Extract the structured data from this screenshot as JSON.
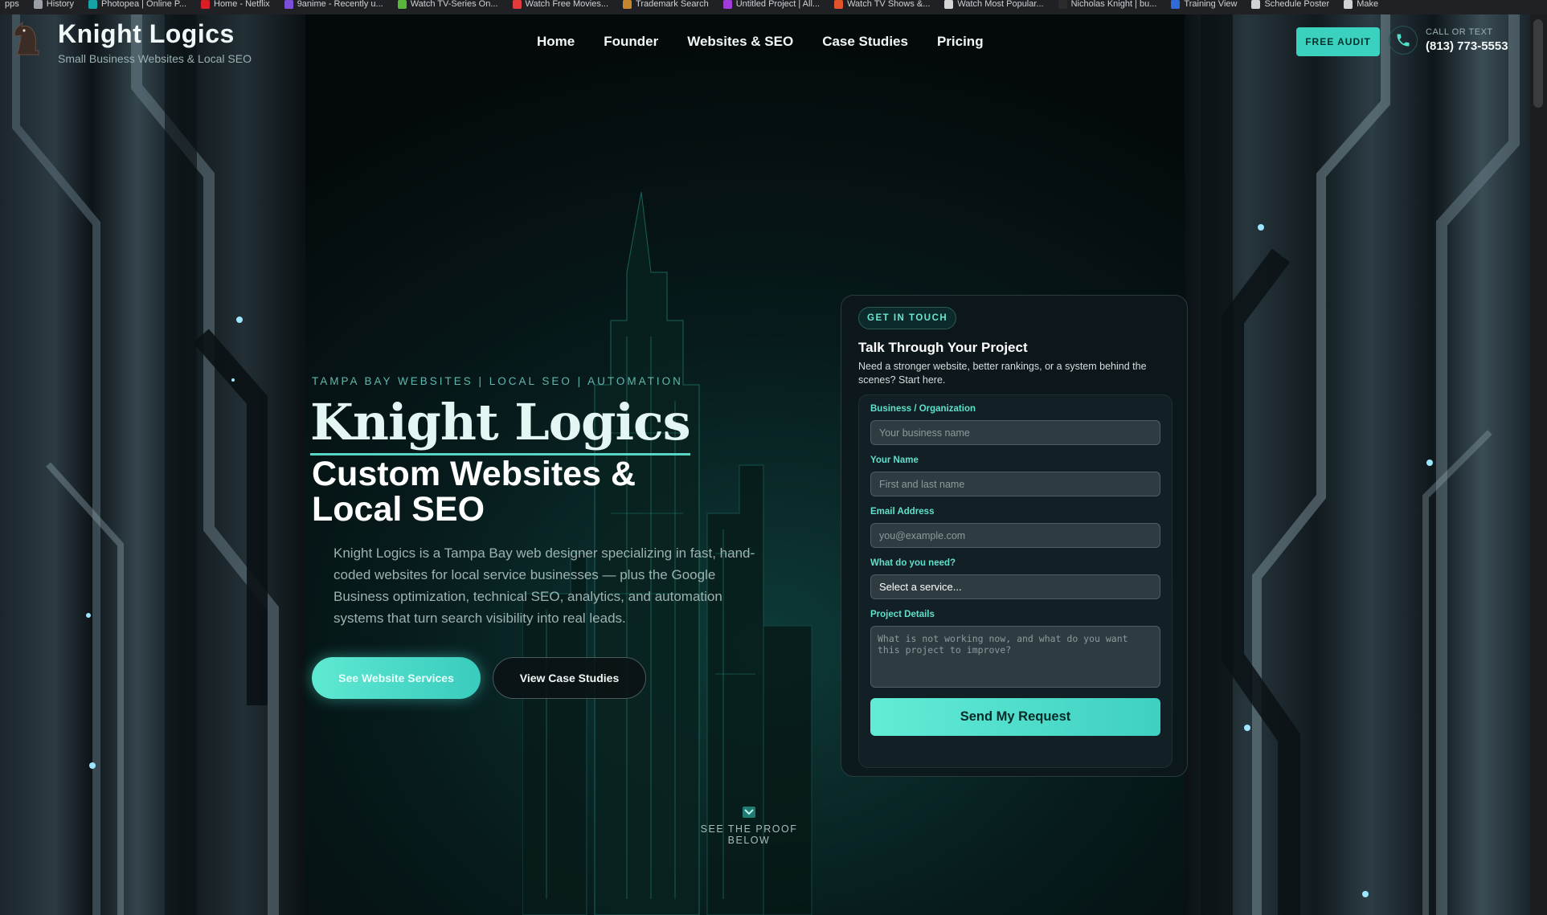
{
  "bookmarks": [
    {
      "label": "pps",
      "color": "#9aa0a6"
    },
    {
      "label": "History",
      "color": "#9aa0a6"
    },
    {
      "label": "Photopea | Online P...",
      "color": "#17a2a6"
    },
    {
      "label": "Home - Netflix",
      "color": "#d81f26"
    },
    {
      "label": "9anime - Recently u...",
      "color": "#7b4fd8"
    },
    {
      "label": "Watch TV-Series On...",
      "color": "#58b63a"
    },
    {
      "label": "Watch Free Movies...",
      "color": "#e13b3b"
    },
    {
      "label": "Trademark Search",
      "color": "#c5872d"
    },
    {
      "label": "Untitled Project | All...",
      "color": "#a13bd9"
    },
    {
      "label": "Watch TV Shows &...",
      "color": "#e2522d"
    },
    {
      "label": "Watch Most Popular...",
      "color": "#d5d5d5"
    },
    {
      "label": "Nicholas Knight | bu...",
      "color": "#2b2b2b"
    },
    {
      "label": "Training View",
      "color": "#2f6bd9"
    },
    {
      "label": "Schedule Poster",
      "color": "#cfd3d6"
    },
    {
      "label": "Make",
      "color": "#cfd3d6"
    }
  ],
  "header": {
    "logo_title": "Knight Logics",
    "logo_subtitle": "Small Business Websites & Local SEO",
    "nav": [
      "Home",
      "Founder",
      "Websites & SEO",
      "Case Studies",
      "Pricing"
    ],
    "audit_button": "FREE AUDIT",
    "call_label": "CALL OR TEXT",
    "call_number": "(813) 773-5553"
  },
  "hero": {
    "eyebrow": "TAMPA BAY WEBSITES | LOCAL SEO | AUTOMATION",
    "title": "Knight Logics",
    "subtitle": "Custom Websites & Local SEO",
    "description": "Knight Logics is a Tampa Bay web designer specializing in fast, hand-coded websites for local service businesses — plus the Google Business optimization, technical SEO, analytics, and automation systems that turn search visibility into real leads.",
    "primary_button": "See Website Services",
    "secondary_button": "View Case Studies",
    "proof_label": "SEE THE PROOF BELOW"
  },
  "contact": {
    "badge": "GET IN TOUCH",
    "title": "Talk Through Your Project",
    "description": "Need a stronger website, better rankings, or a system behind the scenes? Start here.",
    "fields": {
      "business_label": "Business / Organization",
      "business_placeholder": "Your business name",
      "name_label": "Your Name",
      "name_placeholder": "First and last name",
      "email_label": "Email Address",
      "email_placeholder": "you@example.com",
      "need_label": "What do you need?",
      "need_selected": "Select a service...",
      "details_label": "Project Details",
      "details_placeholder": "What is not working now, and what do you want this project to improve?"
    },
    "submit": "Send My Request"
  },
  "colors": {
    "accent": "#3ad2bf",
    "accent_light": "#62ecd6",
    "background": "#05090b",
    "card": "#0d181c"
  }
}
